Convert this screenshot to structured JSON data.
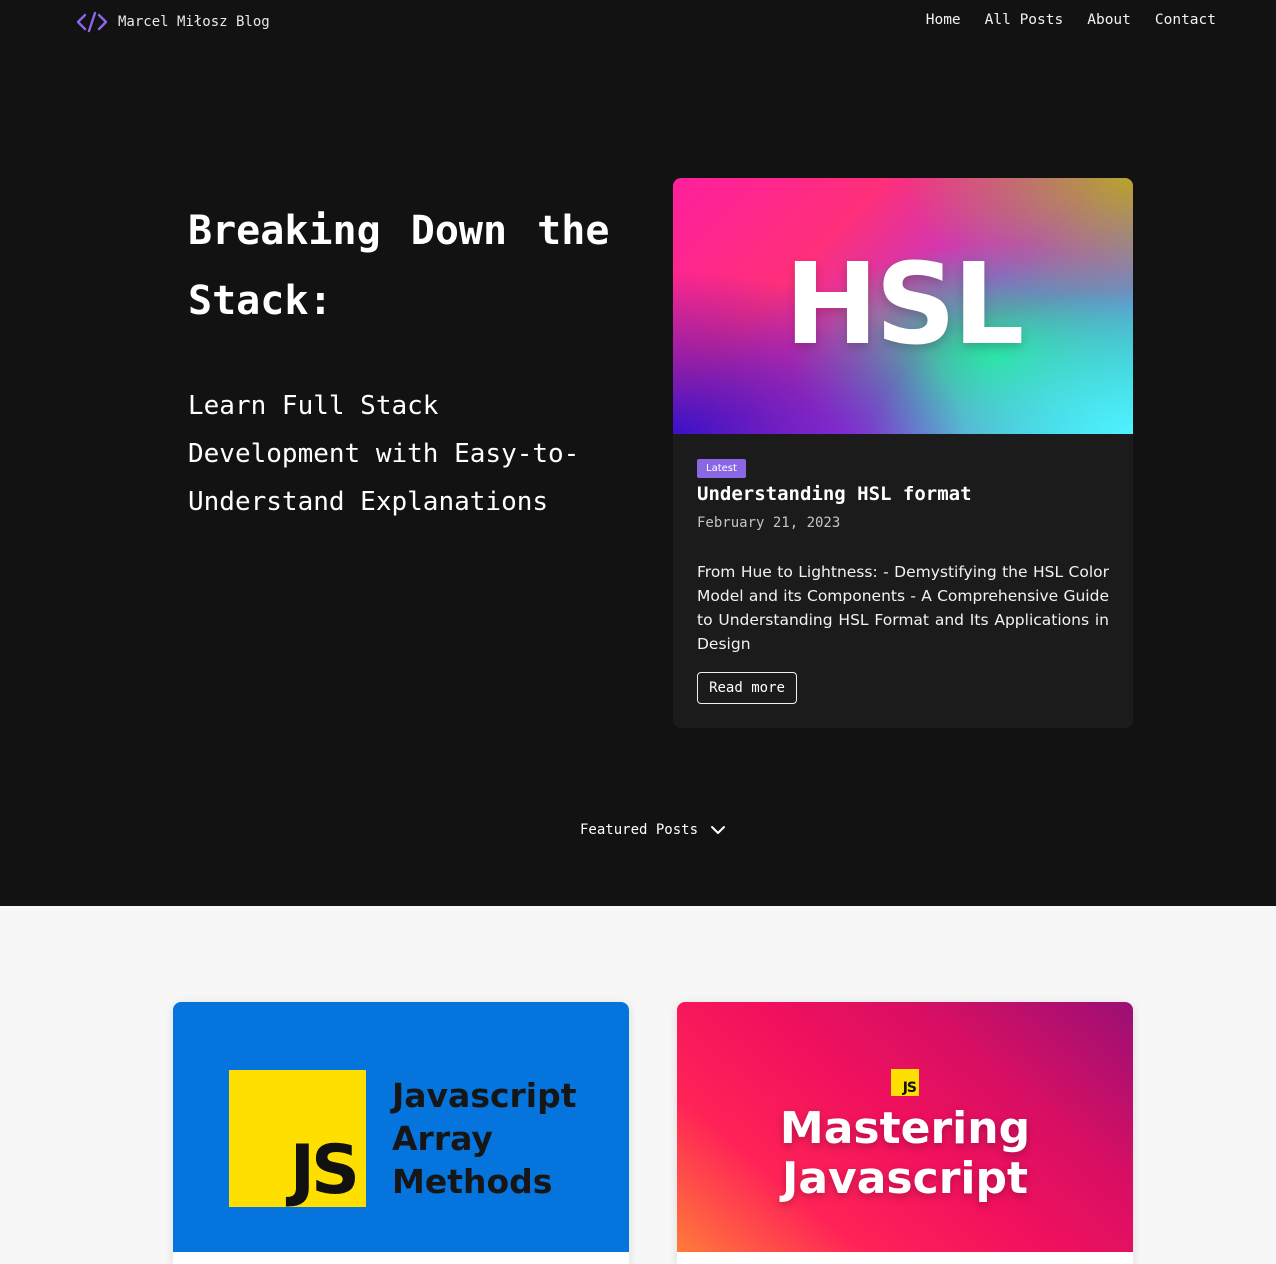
{
  "nav": {
    "logo_text": "Marcel Miłosz Blog",
    "logo_icon": "code-brackets-icon",
    "links": [
      "Home",
      "All Posts",
      "About",
      "Contact"
    ]
  },
  "hero": {
    "title": "Breaking Down the Stack:",
    "subtitle": "Learn Full Stack Development with Easy-to-Understand Explanations"
  },
  "latest": {
    "cover_text": "HSL",
    "badge": "Latest",
    "title": "Understanding HSL format",
    "date": "February 21, 2023",
    "excerpt": "From Hue to Lightness: - Demystifying the HSL Color Model and its Components - A Comprehensive Guide to Understanding HSL Format and Its Applications in Design",
    "read_more": "Read more"
  },
  "featured": {
    "label": "Featured Posts",
    "toggle_icon": "chevron-down-icon",
    "cards": [
      {
        "logo_text": "JS",
        "cover_title": "Javascript Array Methods"
      },
      {
        "logo_text": "JS",
        "cover_title": "Mastering Javascript"
      }
    ]
  },
  "colors": {
    "dark_bg": "#121212",
    "card_bg": "#1b1b1b",
    "accent": "#8b67e6",
    "light_bg": "#f7f7f7",
    "js_yellow": "#ffdf00",
    "js_blue": "#0574dd"
  }
}
